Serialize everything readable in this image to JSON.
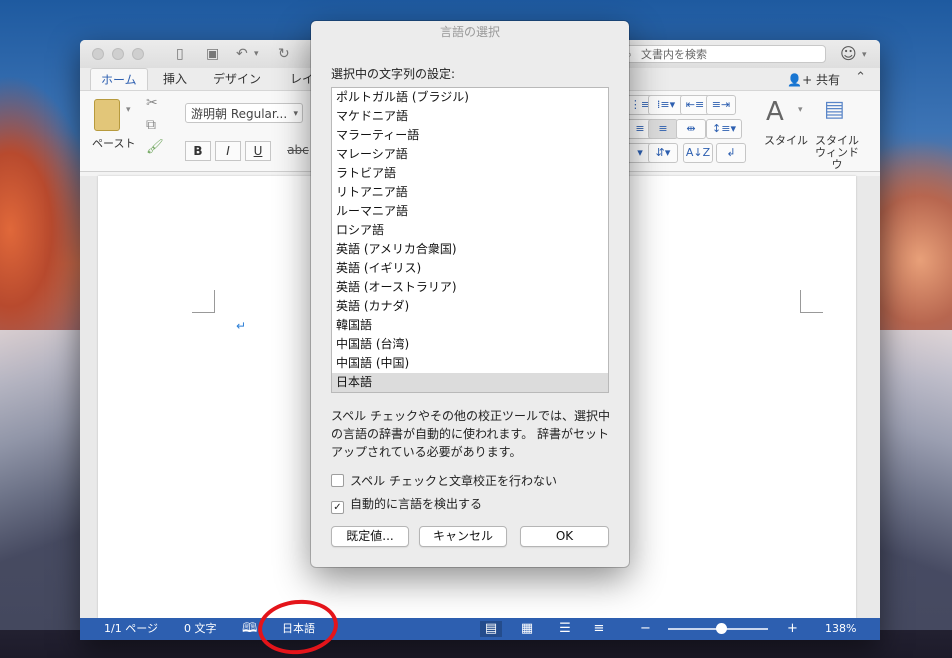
{
  "dialog": {
    "title": "言語の選択",
    "list_label": "選択中の文字列の設定:",
    "languages": [
      "ポルトガル語 (ブラジル)",
      "マケドニア語",
      "マラーティー語",
      "マレーシア語",
      "ラトビア語",
      "リトアニア語",
      "ルーマニア語",
      "ロシア語",
      "英語 (アメリカ合衆国)",
      "英語 (イギリス)",
      "英語 (オーストラリア)",
      "英語 (カナダ)",
      "韓国語",
      "中国語 (台湾)",
      "中国語 (中国)",
      "日本語"
    ],
    "selected_language": "日本語",
    "description": "スペル チェックやその他の校正ツールでは、選択中の言語の辞書が自動的に使われます。 辞書がセットアップされている必要があります。",
    "checkbox_no_proofing": "スペル チェックと文章校正を行わない",
    "checkbox_no_proofing_checked": false,
    "checkbox_autodetect": "自動的に言語を検出する",
    "checkbox_autodetect_checked": true,
    "btn_default": "既定値...",
    "btn_cancel": "キャンセル",
    "btn_ok": "OK"
  },
  "word": {
    "search_placeholder": "文書内を検索",
    "share_label": "共有",
    "tabs": [
      "ホーム",
      "挿入",
      "デザイン",
      "レイ"
    ],
    "paste_label": "ペースト",
    "font_name": "游明朝 Regular...",
    "bold": "B",
    "italic": "I",
    "underline": "U",
    "strike": "abc",
    "styles_label": "スタイル",
    "styles_window_label_1": "スタイル",
    "styles_window_label_2": "ウィンドウ"
  },
  "status_bar": {
    "page": "1/1 ページ",
    "words": "0 文字",
    "language": "日本語",
    "zoom_minus": "−",
    "zoom_plus": "+",
    "zoom": "138%",
    "zoom_level": 1.38
  },
  "colors": {
    "accent": "#2d5fb0",
    "highlight_circle": "#e4141a"
  }
}
